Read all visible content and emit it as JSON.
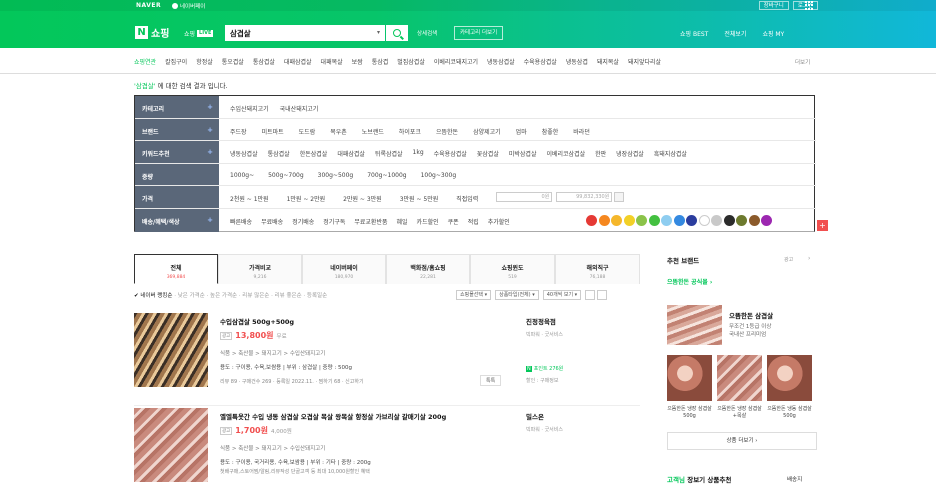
{
  "gnb": {
    "naver": "NAVER",
    "naverpay": "네이버페이",
    "cart": "장바구니",
    "login": "로그인",
    "shop_logo_letter": "N",
    "shop_title": "쇼핑",
    "shop_live_label": "쇼핑",
    "live_tag": "LIVE",
    "search_value": "삼겹살",
    "detail_search": "상세검색",
    "category_more": "카테고리 더보기",
    "best": "쇼핑 BEST",
    "all_service": "전체보기",
    "my": "쇼핑 MY"
  },
  "keywords": {
    "items": [
      "쇼핑연관",
      "칼집구이",
      "항정살",
      "통오겹살",
      "통삼겹살",
      "대패삼겹살",
      "대패목살",
      "보쌈",
      "통삼겹",
      "벌집삼겹살",
      "이베리코돼지고기",
      "냉동삼겹살",
      "수육용삼겹살",
      "냉동삼겹",
      "돼지목살",
      "돼지앞다리살"
    ],
    "more": "더보기"
  },
  "notice": {
    "keyword": "'삼겹살'",
    "rest": " 에 대한 검색 결과 입니다."
  },
  "filters": [
    {
      "head": "카테고리",
      "items": [
        "수입산돼지고기",
        "국내산돼지고기"
      ]
    },
    {
      "head": "브랜드",
      "items": [
        "주드장",
        "미트마트",
        "도드람",
        "목우촌",
        "노브랜드",
        "하이포크",
        "으뜸한돈",
        "삼양제고기",
        "엄마",
        "참좋한",
        "바라던"
      ]
    },
    {
      "head": "키워드추천",
      "items": [
        "냉동삼겹살",
        "통삼겹살",
        "한돈삼겹살",
        "대패삼겹살",
        "뒤록삼겹살",
        "1kg",
        "수육용삼겹살",
        "꽃삼겹살",
        "미박삼겹살",
        "이베리코삼겹살",
        "한판",
        "냉장삼겹살",
        "흑돼지삼겹살"
      ]
    },
    {
      "head": "중량",
      "items": [
        "1000g~",
        "500g~700g",
        "300g~500g",
        "700g~1000g",
        "100g~300g"
      ]
    },
    {
      "head": "가격",
      "items": [
        "2천원 ~ 1만원",
        "1만원 ~ 2만원",
        "2만원 ~ 3만원",
        "3만원 ~ 5만원",
        "직접입력"
      ],
      "price_from": "0원",
      "price_to": "99,832,330원"
    },
    {
      "head": "배송/혜택/색상",
      "items": [
        "빠른배송",
        "무료배송",
        "정기배송",
        "정기구독",
        "무료교환반품",
        "혜일",
        "카드할인",
        "쿠폰",
        "적립",
        "추가할인"
      ]
    }
  ],
  "colors": [
    "#e53935",
    "#f5871f",
    "#f5b72b",
    "#f2d027",
    "#8bc34a",
    "#43c040",
    "#8ecdf0",
    "#3489e0",
    "#2b3d9e",
    "#ffffff",
    "#c9c9c9",
    "#2b2b2b",
    "#6d7a2e",
    "#8b5a2b",
    "#9c27b0"
  ],
  "tabs": [
    {
      "label": "전체",
      "count": "369,884"
    },
    {
      "label": "가격비교",
      "count": "9,216"
    },
    {
      "label": "네이버페이",
      "count": "180,970"
    },
    {
      "label": "백화점/홈쇼핑",
      "count": "22,281"
    },
    {
      "label": "쇼핑윈도",
      "count": "519"
    },
    {
      "label": "해외직구",
      "count": "76,188"
    }
  ],
  "sort": {
    "items": [
      "✔ 네이버 랭킹순",
      "· 낮은 가격순",
      "· 높은 가격순",
      "· 리뷰 많은순",
      "· 리뷰 좋은순",
      "· 등록일순"
    ],
    "select1": "쇼핑몰선택 ▾",
    "select2": "상품타입(전체) ▾",
    "select3": "40개씩 보기 ▾"
  },
  "products": [
    {
      "title": "수입삼겹살 500g+500g",
      "ad": "광고",
      "price": "13,800원",
      "shipping": "무료",
      "category": "식품 > 축산물 > 돼지고기 > 수입산돼지고기",
      "spec": "용도 : 구이용, 수육,보쌈용 | 부위 : 삼겹살 | 중량 : 500g",
      "meta": "리뷰 89 · 구매건수 269 · 등록일 2022.11. · 찜하기 68 · 신고하기",
      "jjim": "톡톡",
      "seller": "진정정육점",
      "seller_tags": "빅파워 · 굿서비스",
      "npay": "포인트 276원",
      "coupon": "할인 : 구매정보"
    },
    {
      "title": "옐엘특옷간 수입 냉동 삼겹살 오겹살 목살 왕목살 항정살 가브리살 갈매기살 200g",
      "ad": "광고",
      "price": "1,700원",
      "shipping": "4,000원",
      "category": "식품 > 축산물 > 돼지고기 > 수입산돼지고기",
      "spec": "용도 : 구이용, 국거리용, 수육,보쌈용 | 부위 : 기타 | 중량 : 200g",
      "meta": "첫배구매,스토어찜/알림,리뷰작성 단골고객 등 최대 10,000원할인 혜택",
      "seller": "밀스온",
      "seller_tags": "빅파워 · 굿서비스"
    }
  ],
  "side": {
    "title": "추천 브랜드",
    "ad": "광고",
    "brand": "으뜸한돈 공식몰 ›",
    "main_title": "으뜸한돈 삼겹살",
    "main_sub1": "무조건 1등급 이상",
    "main_sub2": "국내산 프리미엄",
    "caps": [
      "으뜸한돈 냉장 삼겹살 500g",
      "으뜸한돈 냉장 삼겹살+목살",
      "으뜸한돈 냉동 삼겹살 500g"
    ],
    "more": "상품 더보기 ›",
    "bottom_user": "고객님",
    "bottom_rest": " 장보기 상품추천",
    "region": "배송지"
  }
}
